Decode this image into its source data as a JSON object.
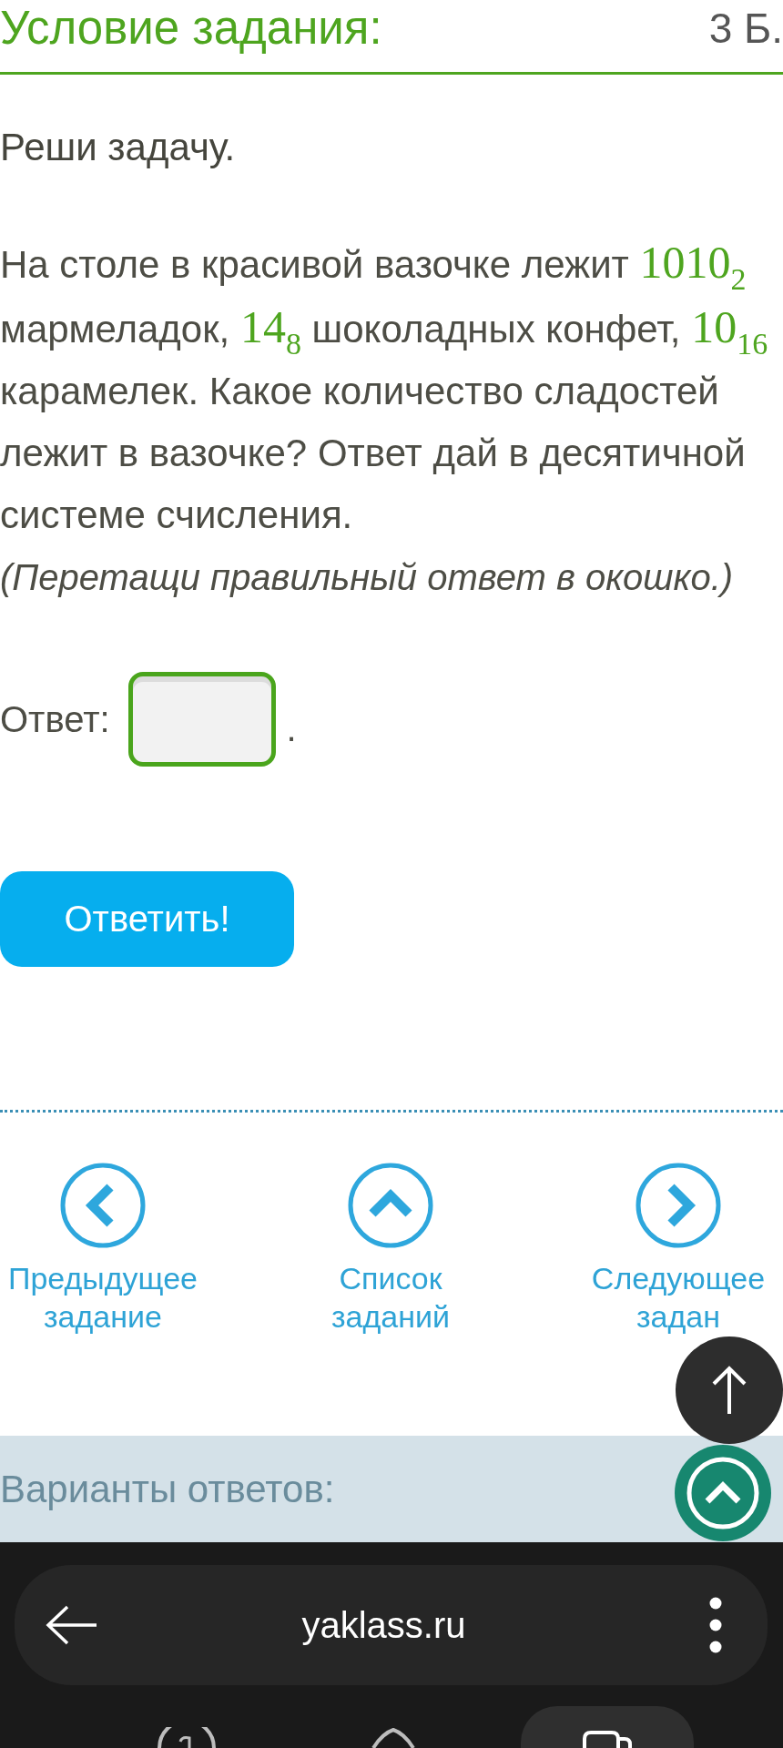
{
  "task_header": {
    "title": "Условие задания:",
    "points": "3 Б."
  },
  "instruction": "Реши задачу.",
  "problem": {
    "parts": [
      {
        "kind": "text",
        "text": "На столе в красивой вазочке лежит "
      },
      {
        "kind": "number",
        "digits": "1010",
        "base": "2"
      },
      {
        "kind": "text",
        "text": " мармеладок, "
      },
      {
        "kind": "number",
        "digits": "14",
        "base": "8"
      },
      {
        "kind": "text",
        "text": " шоколадных конфет, "
      },
      {
        "kind": "number",
        "digits": "10",
        "base": "16"
      },
      {
        "kind": "text",
        "text": " карамелек. Какое количество сладостей лежит в вазочке? Ответ дай в десятичной системе счисления."
      }
    ],
    "hint": "(Перетащи правильный ответ в окошко.)"
  },
  "answer": {
    "label": "Ответ:",
    "suffix": "."
  },
  "submit_button": "Ответить!",
  "task_nav": [
    {
      "kind": "previous",
      "label": "Предыдущее задание"
    },
    {
      "kind": "list",
      "label": "Список заданий"
    },
    {
      "kind": "next",
      "label": "Следующее задан"
    }
  ],
  "options_panel": {
    "title": "Варианты ответов:"
  },
  "browser_bar": {
    "url": "yaklass.ru"
  }
}
